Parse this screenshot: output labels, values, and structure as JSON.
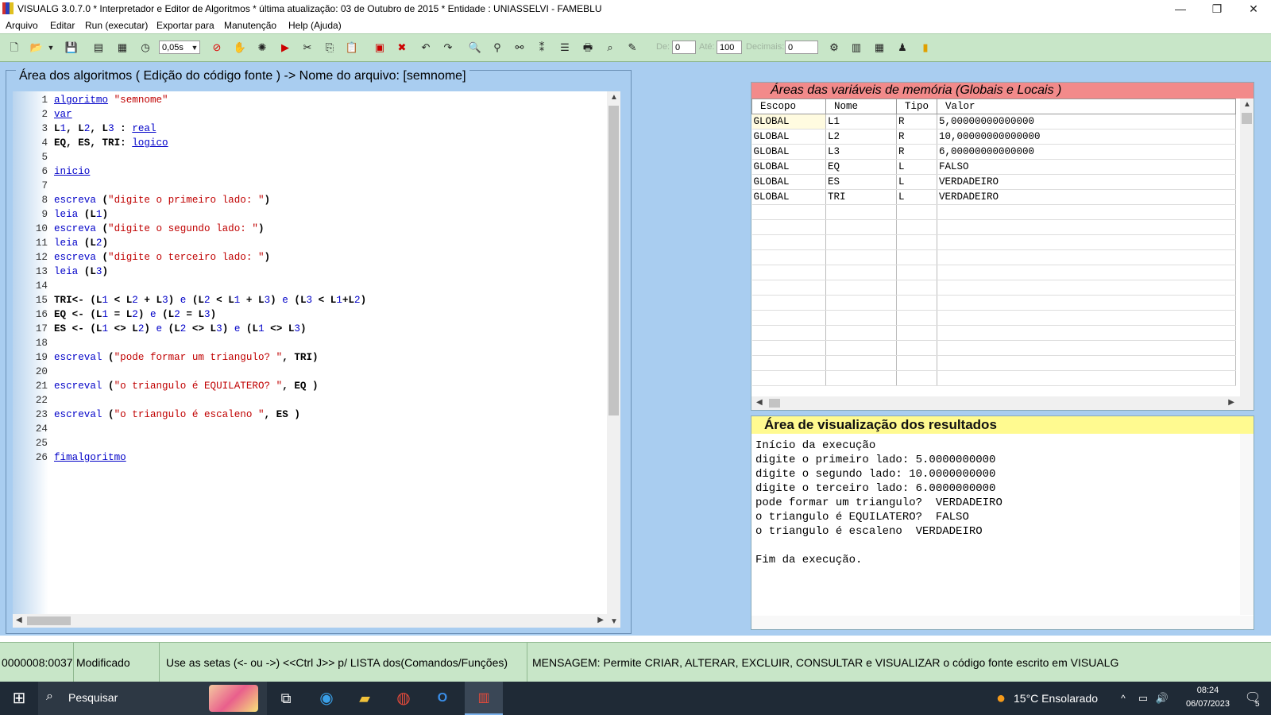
{
  "window": {
    "title": "VISUALG 3.0.7.0 * Interpretador e Editor de Algoritmos * última atualização: 03 de Outubro de 2015 * Entidade : UNIASSELVI - FAMEBLU",
    "minimize": "—",
    "restore": "❐",
    "close": "✕"
  },
  "menu": [
    "Arquivo",
    "Editar",
    "Run (executar)",
    "Exportar para",
    "Manutenção",
    "Help (Ajuda)"
  ],
  "toolbar": {
    "speed": "0,05s",
    "de_label": "De:",
    "de_value": "0",
    "ate_label": "Até:",
    "ate_value": "100",
    "decimais_label": "Decimais:",
    "decimais_value": "0"
  },
  "editor": {
    "title": "Área dos algoritmos ( Edição do código fonte ) -> Nome do arquivo: [semnome]",
    "lines": [
      {
        "n": "1",
        "t": "algoritmo \"semnome\""
      },
      {
        "n": "2",
        "t": "var"
      },
      {
        "n": "3",
        "t": "L1, L2, L3 : real"
      },
      {
        "n": "4",
        "t": "EQ, ES, TRI: logico"
      },
      {
        "n": "5",
        "t": ""
      },
      {
        "n": "6",
        "t": "inicio"
      },
      {
        "n": "7",
        "t": ""
      },
      {
        "n": "8",
        "t": "escreva (\"digite o primeiro lado: \")"
      },
      {
        "n": "9",
        "t": "leia (L1)"
      },
      {
        "n": "10",
        "t": "escreva (\"digite o segundo lado: \")"
      },
      {
        "n": "11",
        "t": "leia (L2)"
      },
      {
        "n": "12",
        "t": "escreva (\"digite o terceiro lado: \")"
      },
      {
        "n": "13",
        "t": "leia (L3)"
      },
      {
        "n": "14",
        "t": ""
      },
      {
        "n": "15",
        "t": "TRI<- (L1 < L2 + L3) e (L2 < L1 + L3) e (L3 < L1+L2)"
      },
      {
        "n": "16",
        "t": "EQ <- (L1 = L2) e (L2 = L3)"
      },
      {
        "n": "17",
        "t": "ES <- (L1 <> L2) e (L2 <> L3) e (L1 <> L3)"
      },
      {
        "n": "18",
        "t": ""
      },
      {
        "n": "19",
        "t": "escreval (\"pode formar um triangulo? \", TRI)"
      },
      {
        "n": "20",
        "t": ""
      },
      {
        "n": "21",
        "t": "escreval (\"o triangulo é EQUILATERO? \", EQ )"
      },
      {
        "n": "22",
        "t": ""
      },
      {
        "n": "23",
        "t": "escreval (\"o triangulo é escaleno \", ES )"
      },
      {
        "n": "24",
        "t": ""
      },
      {
        "n": "25",
        "t": ""
      },
      {
        "n": "26",
        "t": "fimalgoritmo"
      }
    ]
  },
  "variables": {
    "title": "Áreas das variáveis de memória (Globais e Locais )",
    "headers": [
      "Escopo",
      "Nome",
      "Tipo",
      "Valor"
    ],
    "rows": [
      [
        "GLOBAL",
        "L1",
        "R",
        "5,00000000000000"
      ],
      [
        "GLOBAL",
        "L2",
        "R",
        "10,00000000000000"
      ],
      [
        "GLOBAL",
        "L3",
        "R",
        "6,00000000000000"
      ],
      [
        "GLOBAL",
        "EQ",
        "L",
        "FALSO"
      ],
      [
        "GLOBAL",
        "ES",
        "L",
        "VERDADEIRO"
      ],
      [
        "GLOBAL",
        "TRI",
        "L",
        "VERDADEIRO"
      ]
    ]
  },
  "results": {
    "title": "Área de visualização dos resultados",
    "lines": [
      "Início da execução",
      "digite o primeiro lado: 5.0000000000",
      "digite o segundo lado: 10.0000000000",
      "digite o terceiro lado: 6.0000000000",
      "pode formar um triangulo?  VERDADEIRO",
      "o triangulo é EQUILATERO?  FALSO",
      "o triangulo é escaleno  VERDADEIRO",
      "",
      "Fim da execução."
    ]
  },
  "status": {
    "position": "0000008:0037",
    "state": "Modificado",
    "hint": "Use as setas (<- ou ->) <<Ctrl J>> p/ LISTA dos(Comandos/Funções)",
    "message": "MENSAGEM: Permite CRIAR, ALTERAR, EXCLUIR, CONSULTAR e VISUALIZAR o código fonte escrito em VISUALG"
  },
  "taskbar": {
    "search": "Pesquisar",
    "weather": "15°C  Ensolarado",
    "time": "08:24",
    "date": "06/07/2023",
    "notif_count": "5"
  }
}
